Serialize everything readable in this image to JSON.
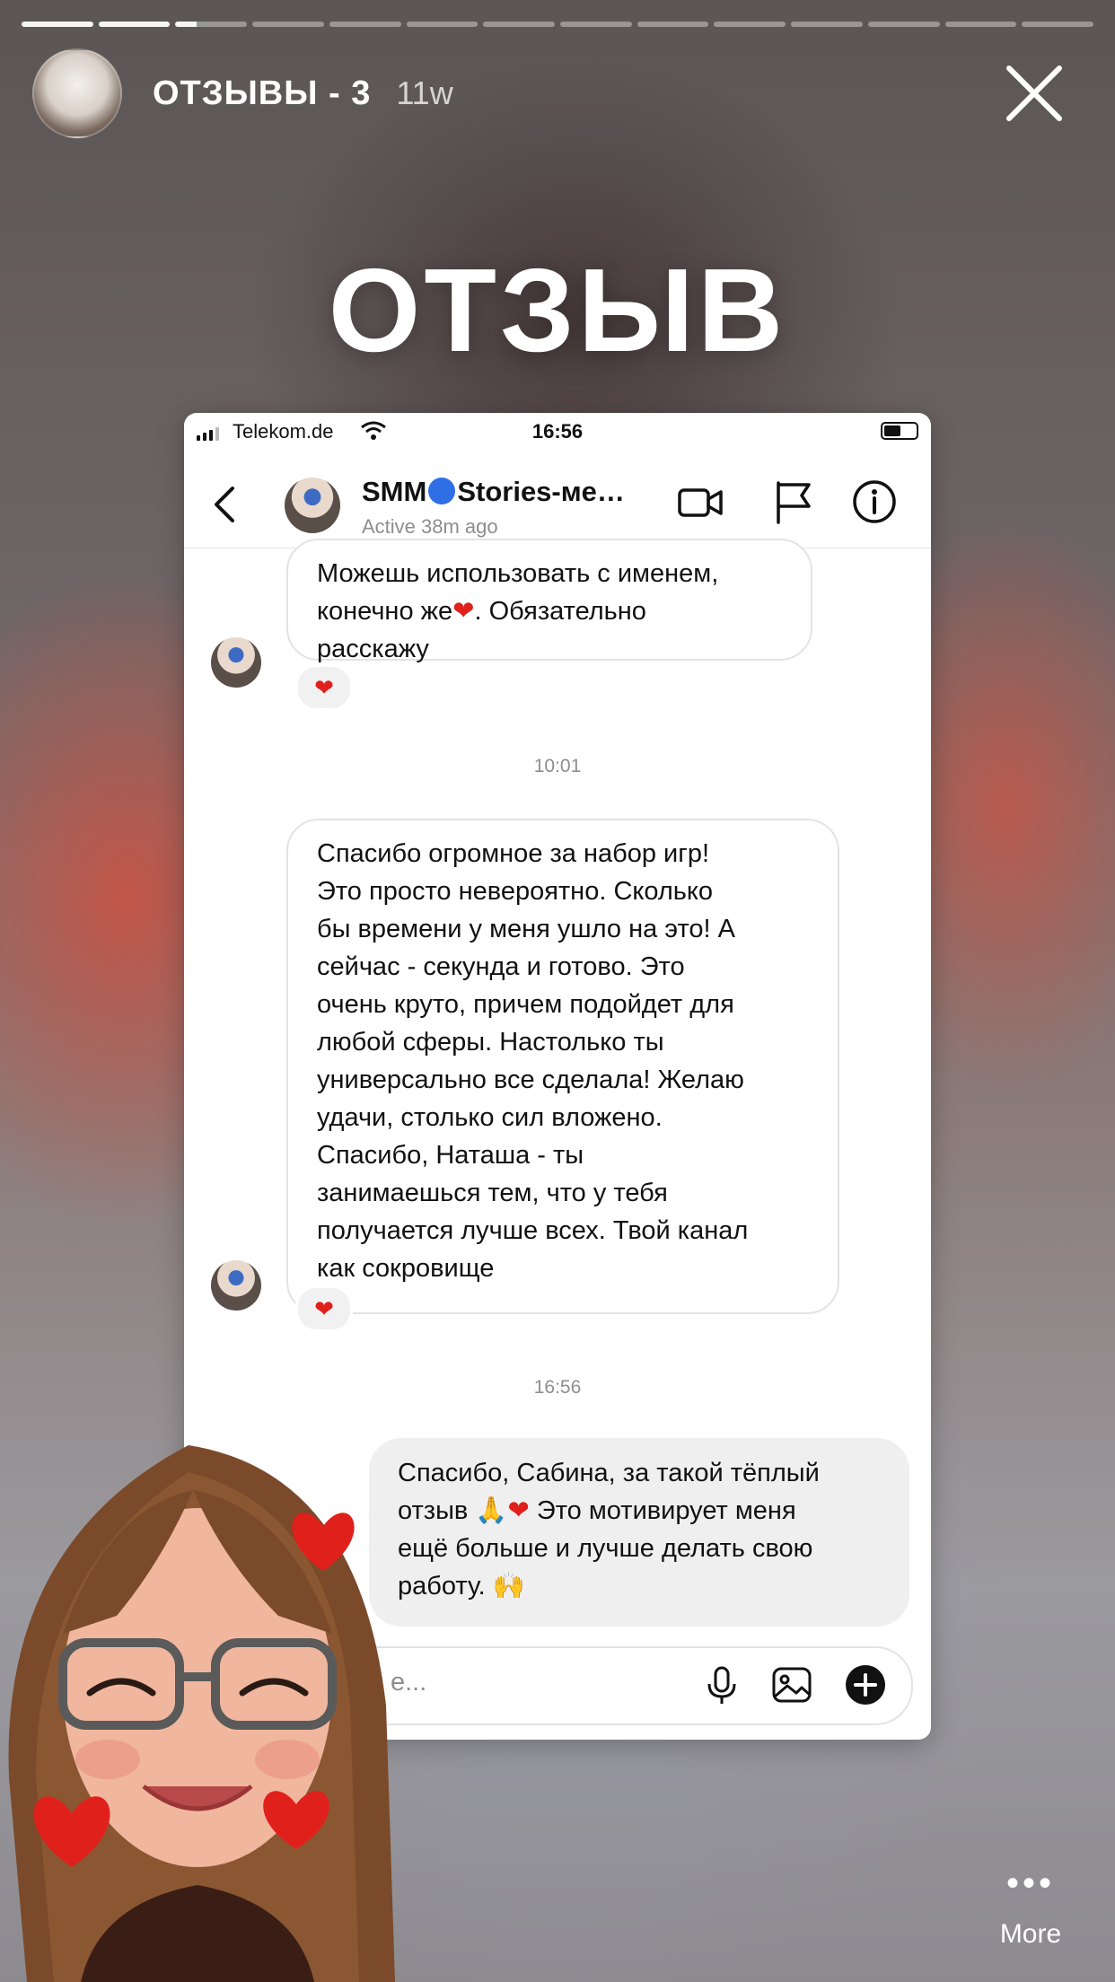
{
  "story": {
    "title": "ОТЗЫВЫ - 3",
    "time": "11w",
    "overlay_text": "ОТЗЫВ",
    "segments_total": 14,
    "segments_done": 2,
    "more_label": "More"
  },
  "phone": {
    "status_bar": {
      "carrier": "Telekom.de",
      "time": "16:56"
    },
    "chat": {
      "name_left": "SMM",
      "name_right": "Stories-ме…",
      "status": "Active 38m ago"
    },
    "messages": [
      {
        "lines": [
          "Можешь использовать с именем,",
          "конечно же",
          ". Обязательно",
          "расскажу"
        ],
        "reaction": "❤"
      },
      {
        "timestamp": "10:01"
      },
      {
        "lines": [
          "Спасибо огромное за набор игр!",
          "Это просто невероятно. Сколько",
          "бы времени у меня ушло на это! А",
          "сейчас - секунда и готово. Это",
          "очень круто, причем подойдет для",
          "любой сферы. Настолько ты",
          "универсально все сделала! Желаю",
          "удачи, столько сил вложено.",
          "Спасибо, Наташа - ты",
          "занимаешься тем, что у тебя",
          "получается лучше всех. Твой канал",
          "как сокровище"
        ],
        "reaction": "❤"
      },
      {
        "timestamp": "16:56"
      },
      {
        "lines": [
          "Спасибо, Сабина, за такой тёплый",
          "отзыв",
          "🙏❤",
          "Это мотивирует меня",
          "ещё больше и лучше делать свою",
          "работу.",
          "🙌"
        ]
      }
    ],
    "composer_placeholder": "е..."
  },
  "colors": {
    "accent_blue": "#2e6fe6",
    "heart_red": "#e0201b",
    "bubble_out": "#efefef"
  },
  "icons": [
    "close-icon",
    "back-chevron-icon",
    "video-call-icon",
    "flag-icon",
    "info-icon",
    "microphone-icon",
    "gallery-icon",
    "plus-icon",
    "more-dots-icon",
    "heart-icon"
  ]
}
